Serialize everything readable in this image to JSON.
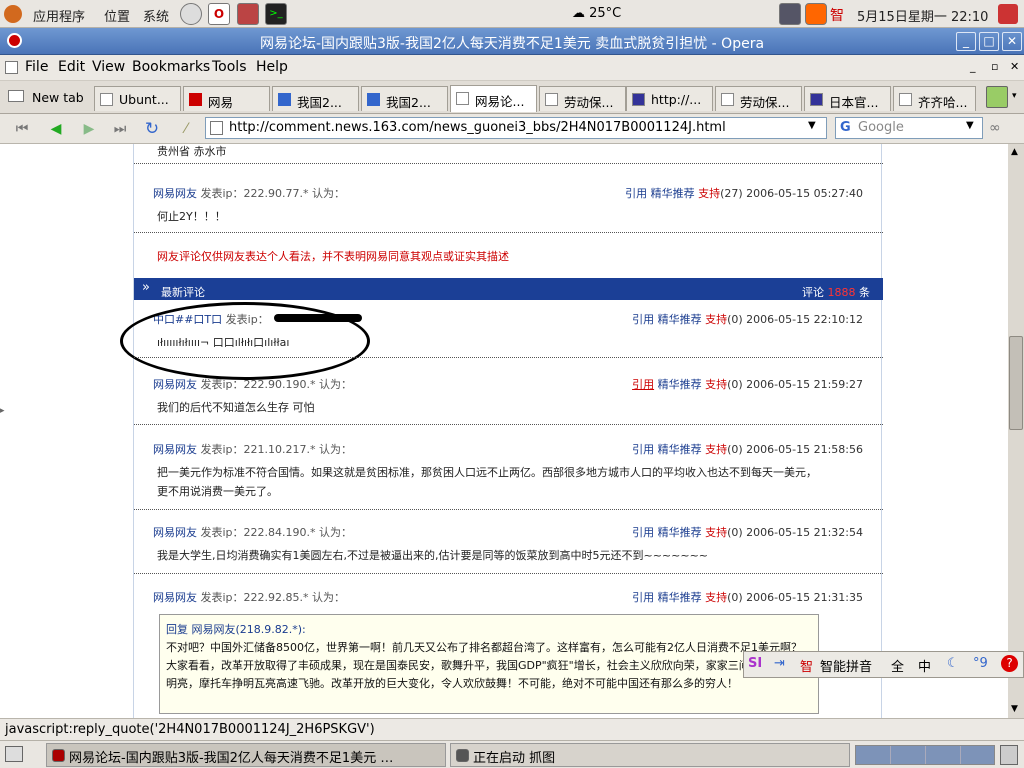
{
  "top_panel": {
    "apps": "应用程序",
    "places": "位置",
    "system": "系统",
    "weather": "25°C",
    "clock": "5月15日星期一 22:10"
  },
  "window": {
    "title": "网易论坛-国内跟贴3版-我国2亿人每天消费不足1美元 卖血式脱贫引担忧 - Opera"
  },
  "menu": [
    "File",
    "Edit",
    "View",
    "Bookmarks",
    "Tools",
    "Help"
  ],
  "tabs": [
    {
      "label": "New tab"
    },
    {
      "label": "Ubunt..."
    },
    {
      "label": "网易"
    },
    {
      "label": "我国2..."
    },
    {
      "label": "我国2..."
    },
    {
      "label": "网易论..."
    },
    {
      "label": "劳动保..."
    },
    {
      "label": "http://..."
    },
    {
      "label": "劳动保..."
    },
    {
      "label": "日本官..."
    },
    {
      "label": "齐齐哈..."
    }
  ],
  "nav": {
    "url": "http://comment.news.163.com/news_guonei3_bbs/2H4N017B0001124J.html",
    "search_placeholder": "Google"
  },
  "page": {
    "location_line": "贵州省 赤水市",
    "comments_top": [
      {
        "user": "网易网友",
        "ip": "发表ip：222.90.77.* 认为：",
        "actions": {
          "quote": "引用",
          "recommend": "精华推荐",
          "support": "支持",
          "count": "(27)",
          "time": "2006-05-15 05:27:40"
        },
        "text": "何止2Y！！！"
      }
    ],
    "disclaimer": "网友评论仅供网友表达个人看法，并不表明网易同意其观点或证实其描述",
    "latest_bar": {
      "label": "最新评论",
      "count_label": "评论",
      "count_value": "1888",
      "count_unit": "条",
      "arrow": "»"
    },
    "comments": [
      {
        "user": "中口##口T口",
        "ip": "发表ip：",
        "actions": {
          "quote": "引用",
          "recommend": "精华推荐",
          "support": "支持",
          "count": "(0)",
          "time": "2006-05-15 22:10:12"
        },
        "text": "ıłıııııłıłıııı¬ 口口ılłıłı口ılıłłaı"
      },
      {
        "user": "网易网友",
        "ip": "发表ip：222.90.190.* 认为：",
        "actions": {
          "quote": "引用",
          "recommend": "精华推荐",
          "support": "支持",
          "count": "(0)",
          "time": "2006-05-15 21:59:27"
        },
        "text": "我们的后代不知道怎么生存 可怕"
      },
      {
        "user": "网易网友",
        "ip": "发表ip：221.10.217.* 认为：",
        "actions": {
          "quote": "引用",
          "recommend": "精华推荐",
          "support": "支持",
          "count": "(0)",
          "time": "2006-05-15 21:58:56"
        },
        "text": "把一美元作为标准不符合国情。如果这就是贫困标准，那贫困人口远不止两亿。西部很多地方城市人口的平均收入也达不到每天一美元，更不用说消费一美元了。"
      },
      {
        "user": "网易网友",
        "ip": "发表ip：222.84.190.* 认为：",
        "actions": {
          "quote": "引用",
          "recommend": "精华推荐",
          "support": "支持",
          "count": "(0)",
          "time": "2006-05-15 21:32:54"
        },
        "text": "我是大学生,日均消费确实有1美圆左右,不过是被逼出来的,估计要是同等的饭菜放到高中时5元还不到~~~~~~~"
      },
      {
        "user": "网易网友",
        "ip": "发表ip：222.92.85.* 认为：",
        "actions": {
          "quote": "引用",
          "recommend": "精华推荐",
          "support": "支持",
          "count": "(0)",
          "time": "2006-05-15 21:31:35"
        },
        "text": ""
      }
    ],
    "quote": {
      "header": "回复 网易网友(218.9.82.*):",
      "text": "不对吧？中国外汇储备8500亿，世界第一啊！前几天又公布了排名都超台湾了。这样富有，怎么可能有2亿人日消费不足1美元啊？大家看看，改革开放取得了丰硕成果，现在是国泰民安，歌舞升平，我国GDP\"疯狂\"增长，社会主义欣欣向荣，家家三间大瓦房宽敞明亮，摩托车挣明瓦亮高速飞驰。改革开放的巨大变化，令人欢欣鼓舞！不可能，绝对不可能中国还有那么多的穷人！"
    }
  },
  "ime": {
    "name": "智能拼音",
    "full": "全",
    "zh": "中",
    "punct": "°9"
  },
  "status": "javascript:reply_quote('2H4N017B0001124J_2H6PSKGV')",
  "taskbar": [
    {
      "label": "网易论坛-国内跟贴3版-我国2亿人每天消费不足1美元 …"
    },
    {
      "label": "正在启动 抓图"
    }
  ],
  "colors": {
    "accent": "#1b3f96",
    "highlight": "#cc0000",
    "title_blue": "#4a74b8"
  }
}
